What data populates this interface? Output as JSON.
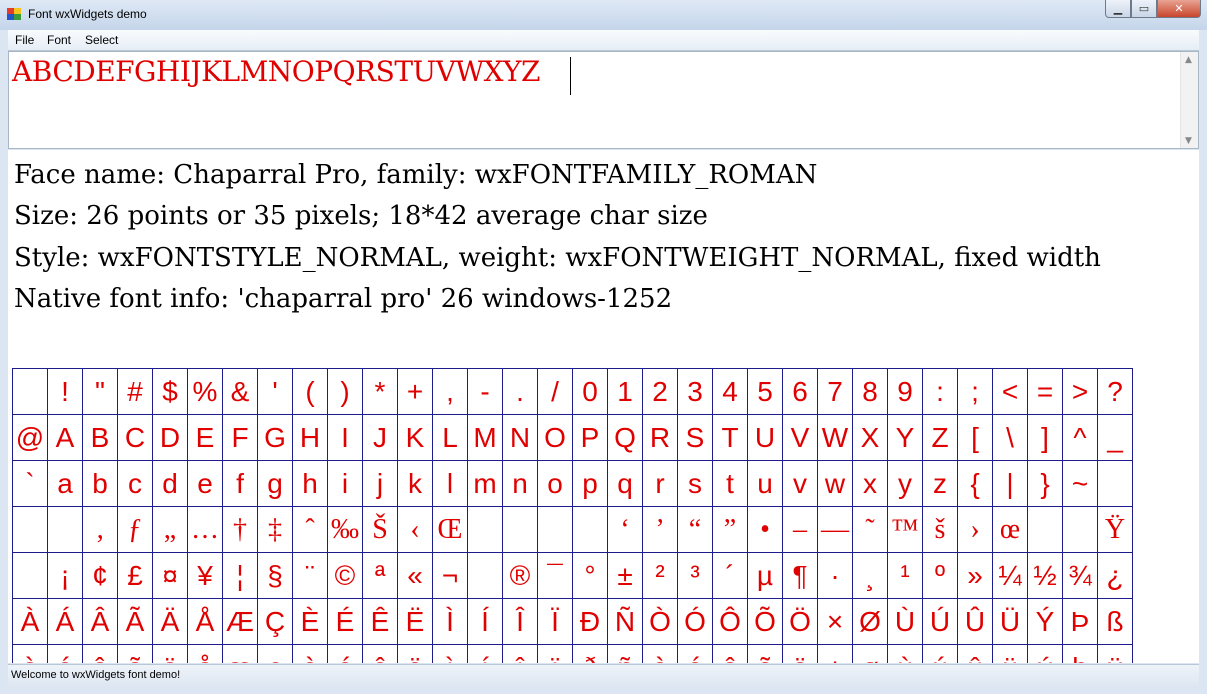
{
  "window": {
    "title": "Font wxWidgets demo"
  },
  "menu": {
    "file": "File",
    "font": "Font",
    "select": "Select"
  },
  "textbox": {
    "value": "ABCDEFGHIJKLMNOPQRSTUVWXYZ"
  },
  "info": {
    "line1": "Face name: Chaparral Pro, family: wxFONTFAMILY_ROMAN",
    "line2": "Size: 26 points or 35 pixels; 18*42 average char size",
    "line3": "Style: wxFONTSTYLE_NORMAL, weight: wxFONTWEIGHT_NORMAL, fixed width",
    "line4": "Native font info: 'chaparral pro' 26 windows-1252"
  },
  "charmap": {
    "rows": [
      [
        " ",
        "!",
        "\"",
        "#",
        "$",
        "%",
        "&",
        "'",
        "(",
        ")",
        "*",
        "+",
        ",",
        "-",
        ".",
        "/",
        "0",
        "1",
        "2",
        "3",
        "4",
        "5",
        "6",
        "7",
        "8",
        "9",
        ":",
        ";",
        "<",
        "=",
        ">",
        "?"
      ],
      [
        "@",
        "A",
        "B",
        "C",
        "D",
        "E",
        "F",
        "G",
        "H",
        "I",
        "J",
        "K",
        "L",
        "M",
        "N",
        "O",
        "P",
        "Q",
        "R",
        "S",
        "T",
        "U",
        "V",
        "W",
        "X",
        "Y",
        "Z",
        "[",
        "\\",
        "]",
        "^",
        "_"
      ],
      [
        "`",
        "a",
        "b",
        "c",
        "d",
        "e",
        "f",
        "g",
        "h",
        "i",
        "j",
        "k",
        "l",
        "m",
        "n",
        "o",
        "p",
        "q",
        "r",
        "s",
        "t",
        "u",
        "v",
        "w",
        "x",
        "y",
        "z",
        "{",
        "|",
        "}",
        "~",
        ""
      ],
      [
        "",
        "",
        "‚",
        "ƒ",
        "„",
        "…",
        "†",
        "‡",
        "ˆ",
        "‰",
        "Š",
        "‹",
        "Œ",
        "",
        "",
        "",
        "",
        "‘",
        "’",
        "“",
        "”",
        "•",
        "–",
        "—",
        "˜",
        "™",
        "š",
        "›",
        "œ",
        "",
        "",
        "Ÿ"
      ],
      [
        "",
        "¡",
        "¢",
        "£",
        "¤",
        "¥",
        "¦",
        "§",
        "¨",
        "©",
        "ª",
        "«",
        "¬",
        "",
        "®",
        "¯",
        "°",
        "±",
        "²",
        "³",
        "´",
        "µ",
        "¶",
        "·",
        "¸",
        "¹",
        "º",
        "»",
        "¼",
        "½",
        "¾",
        "¿"
      ],
      [
        "À",
        "Á",
        "Â",
        "Ã",
        "Ä",
        "Å",
        "Æ",
        "Ç",
        "È",
        "É",
        "Ê",
        "Ë",
        "Ì",
        "Í",
        "Î",
        "Ï",
        "Ð",
        "Ñ",
        "Ò",
        "Ó",
        "Ô",
        "Õ",
        "Ö",
        "×",
        "Ø",
        "Ù",
        "Ú",
        "Û",
        "Ü",
        "Ý",
        "Þ",
        "ß"
      ],
      [
        "à",
        "á",
        "â",
        "ã",
        "ä",
        "å",
        "æ",
        "ç",
        "è",
        "é",
        "ê",
        "ë",
        "ì",
        "í",
        "î",
        "ï",
        "ð",
        "ñ",
        "ò",
        "ó",
        "ô",
        "õ",
        "ö",
        "÷",
        "ø",
        "ù",
        "ú",
        "û",
        "ü",
        "ý",
        "þ",
        "ÿ"
      ]
    ]
  },
  "statusbar": {
    "text": "Welcome to wxWidgets font demo!"
  },
  "colors": {
    "text_red": "#e00000",
    "grid_blue": "#1c1c8c"
  }
}
